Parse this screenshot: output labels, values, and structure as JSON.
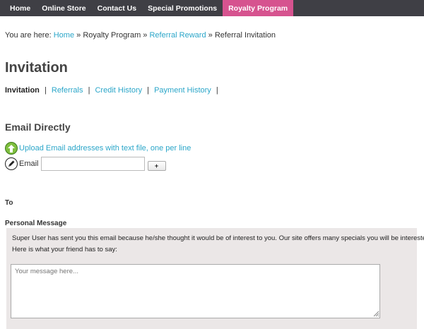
{
  "nav": {
    "items": [
      {
        "label": "Home"
      },
      {
        "label": "Online Store"
      },
      {
        "label": "Contact Us"
      },
      {
        "label": "Special Promotions"
      },
      {
        "label": "Royalty Program"
      }
    ],
    "active_color": "#d6538f",
    "bar_color": "#3f3f45"
  },
  "breadcrumb": {
    "prefix": "You are here:",
    "home": "Home",
    "sep": "»",
    "program": "Royalty Program",
    "reward": "Referral Reward",
    "current": "Referral Invitation"
  },
  "page": {
    "title": "Invitation"
  },
  "subnav": {
    "current": "Invitation",
    "sep": "|",
    "links": [
      "Referrals",
      "Credit History",
      "Payment History"
    ]
  },
  "email_section": {
    "title": "Email Directly",
    "upload_label": "Upload Email addresses with text file, one per line",
    "upload_icon": "upload-arrow-icon",
    "email_icon": "pencil-icon",
    "email_label": "Email",
    "email_value": "",
    "add_label": "+"
  },
  "to_label": "To",
  "message": {
    "label": "Personal Message",
    "intro": "Super User has sent you this email because he/she thought it would be of interest to you. Our site offers many specials you will be interested in.",
    "friend_says": "Here is what your friend has to say:",
    "placeholder": "Your message here...",
    "panel_color": "#ebe7e7"
  },
  "link_color": "#2ba6c9"
}
